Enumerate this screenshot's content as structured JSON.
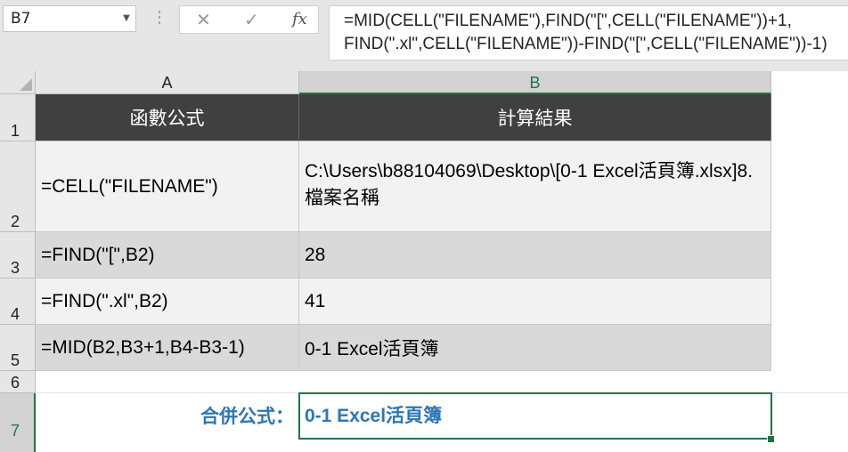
{
  "name_box": {
    "value": "B7"
  },
  "formula_bar": {
    "line1": "=MID(CELL(\"FILENAME\"),FIND(\"[\",CELL(\"FILENAME\"))+1,",
    "line2": "FIND(\".xl\",CELL(\"FILENAME\"))-FIND(\"[\",CELL(\"FILENAME\"))-1)"
  },
  "columns": [
    "A",
    "B"
  ],
  "rows": [
    "1",
    "2",
    "3",
    "4",
    "5",
    "6",
    "7"
  ],
  "table": {
    "headers": [
      "函數公式",
      "計算結果"
    ],
    "rows": [
      {
        "formula": "=CELL(\"FILENAME\")",
        "result": "C:\\Users\\b88104069\\Desktop\\[0-1 Excel活頁簿.xlsx]8.檔案名稱"
      },
      {
        "formula": "=FIND(\"[\",B2)",
        "result": "28"
      },
      {
        "formula": "=FIND(\".xl\",B2)",
        "result": "41"
      },
      {
        "formula": "=MID(B2,B3+1,B4-B3-1)",
        "result": "0-1 Excel活頁簿"
      }
    ]
  },
  "merged": {
    "label": "合併公式：",
    "value": "0-1 Excel活頁簿"
  },
  "colors": {
    "header_bg": "#404040",
    "accent_green": "#217346",
    "result_blue": "#2e75b6"
  }
}
